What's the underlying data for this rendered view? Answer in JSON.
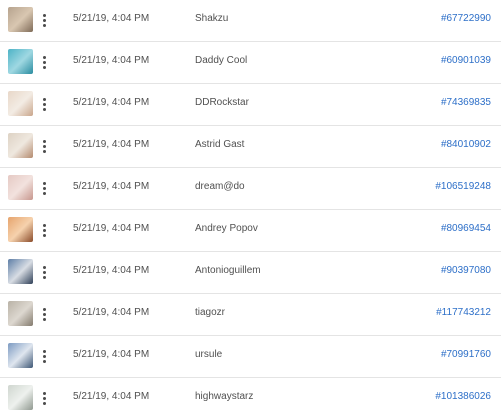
{
  "rows": [
    {
      "date": "5/21/19, 4:04 PM",
      "user": "Shakzu",
      "id": "#67722990",
      "thumb_colors": [
        "#b6a38e",
        "#d9c7b1",
        "#7e6a57"
      ]
    },
    {
      "date": "5/21/19, 4:04 PM",
      "user": "Daddy Cool",
      "id": "#60901039",
      "thumb_colors": [
        "#4db3c6",
        "#9fd8e2",
        "#2a8ca0"
      ]
    },
    {
      "date": "5/21/19, 4:04 PM",
      "user": "DDRockstar",
      "id": "#74369835",
      "thumb_colors": [
        "#e8d7c8",
        "#f3ece4",
        "#c9a58b"
      ]
    },
    {
      "date": "5/21/19, 4:04 PM",
      "user": "Astrid Gast",
      "id": "#84010902",
      "thumb_colors": [
        "#ddd2c4",
        "#efe8df",
        "#b48a6e"
      ]
    },
    {
      "date": "5/21/19, 4:04 PM",
      "user": "dream@do",
      "id": "#106519248",
      "thumb_colors": [
        "#e5c9c4",
        "#f2e2de",
        "#c7968d"
      ]
    },
    {
      "date": "5/21/19, 4:04 PM",
      "user": "Andrey Popov",
      "id": "#80969454",
      "thumb_colors": [
        "#e6a46d",
        "#f6d2ad",
        "#8a4b2a"
      ]
    },
    {
      "date": "5/21/19, 4:04 PM",
      "user": "Antonioguillem",
      "id": "#90397080",
      "thumb_colors": [
        "#5d7ea6",
        "#d8dde4",
        "#2e3f57"
      ]
    },
    {
      "date": "5/21/19, 4:04 PM",
      "user": "tiagozr",
      "id": "#117743212",
      "thumb_colors": [
        "#b9b2a6",
        "#ddd8d0",
        "#837a6d"
      ]
    },
    {
      "date": "5/21/19, 4:04 PM",
      "user": "ursule",
      "id": "#70991760",
      "thumb_colors": [
        "#7c9ac2",
        "#dfe6ef",
        "#3d5674"
      ]
    },
    {
      "date": "5/21/19, 4:04 PM",
      "user": "highwaystarz",
      "id": "#101386026",
      "thumb_colors": [
        "#cfd6cf",
        "#eef1ee",
        "#8f988f"
      ]
    }
  ]
}
